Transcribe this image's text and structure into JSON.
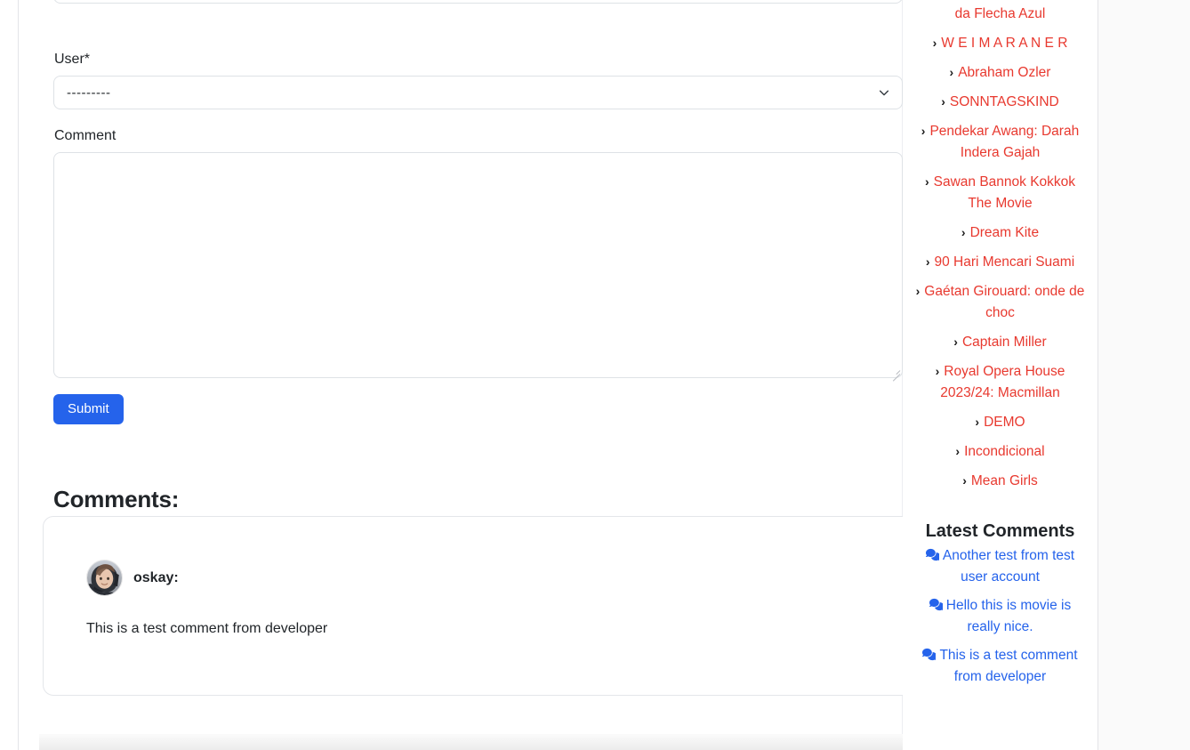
{
  "form": {
    "user_label": "User*",
    "user_select_value": "---------",
    "comment_label": "Comment",
    "comment_value": "",
    "comment_placeholder": "",
    "submit_label": "Submit"
  },
  "comments_section": {
    "heading": "Comments:",
    "items": [
      {
        "author": "oskay:",
        "body": "This is a test comment from developer"
      }
    ]
  },
  "sidebar": {
    "nav_items": [
      {
        "label": "da Flecha Azul",
        "chevron": false,
        "spaced": false
      },
      {
        "label": "W E I M A R A N E R",
        "chevron": true,
        "spaced": false
      },
      {
        "label": "Abraham Ozler",
        "chevron": true,
        "spaced": false
      },
      {
        "label": "SONNTAGSKIND",
        "chevron": true,
        "spaced": false
      },
      {
        "label": "Pendekar Awang: Darah Indera Gajah",
        "chevron": true,
        "spaced": false
      },
      {
        "label": "Sawan Bannok Kokkok The Movie",
        "chevron": true,
        "spaced": false
      },
      {
        "label": "Dream Kite",
        "chevron": true,
        "spaced": false
      },
      {
        "label": "90 Hari Mencari Suami",
        "chevron": true,
        "spaced": false
      },
      {
        "label": "Gaétan Girouard: onde de choc",
        "chevron": true,
        "spaced": false
      },
      {
        "label": "Captain Miller",
        "chevron": true,
        "spaced": false
      },
      {
        "label": "Royal Opera House 2023/24: Macmillan",
        "chevron": true,
        "spaced": false
      },
      {
        "label": "DEMO",
        "chevron": true,
        "spaced": false
      },
      {
        "label": "Incondicional",
        "chevron": true,
        "spaced": false
      },
      {
        "label": "Mean Girls",
        "chevron": true,
        "spaced": false
      }
    ],
    "latest_comments_heading": "Latest Comments",
    "latest_comments": [
      {
        "label": "Another test from test user account"
      },
      {
        "label": "Hello this is movie is really nice."
      },
      {
        "label": "This is a test comment from developer"
      }
    ]
  },
  "icons": {
    "chevron": "›",
    "select_caret": "chevron-down-icon",
    "comments": "comments-icon"
  },
  "colors": {
    "link_red": "#e8392f",
    "link_blue": "#2563eb",
    "submit_blue": "#2563eb",
    "text": "#212529",
    "border": "#dee2e6"
  }
}
